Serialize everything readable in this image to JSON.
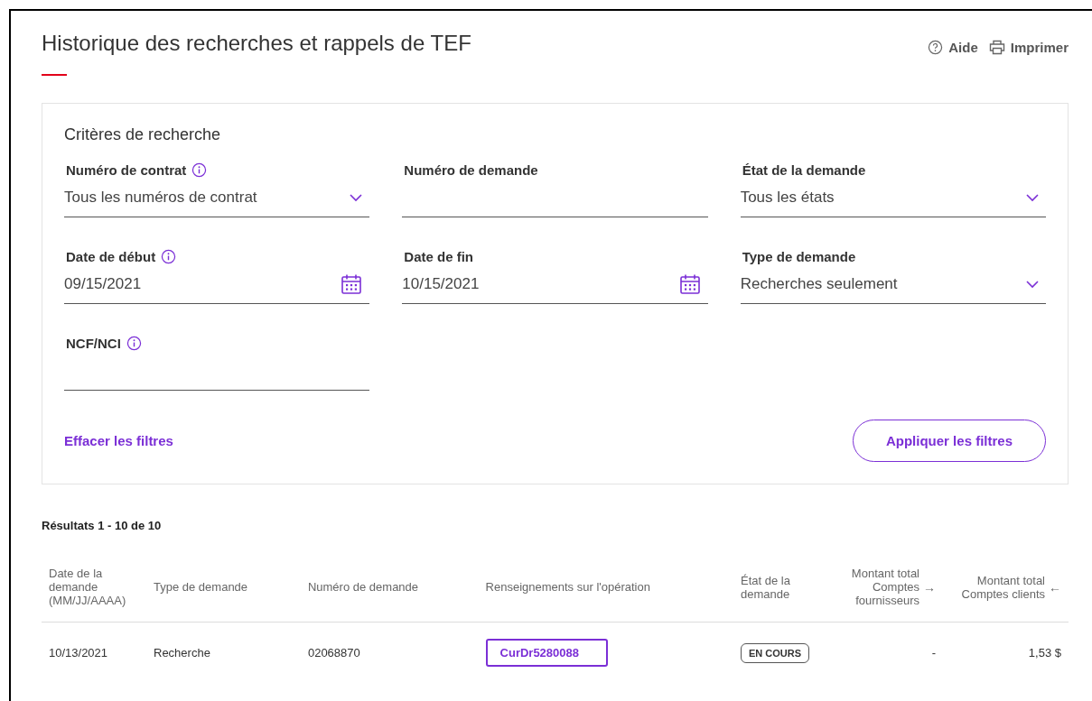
{
  "page": {
    "title": "Historique des recherches et rappels de TEF",
    "actions": [
      {
        "kind": "help",
        "label": "Aide"
      },
      {
        "kind": "print",
        "label": "Imprimer"
      }
    ]
  },
  "criteria": {
    "title": "Critères de recherche",
    "fields": [
      {
        "kind": "select",
        "label": "Numéro de contrat",
        "info": true,
        "value": "Tous les numéros de contrat"
      },
      {
        "kind": "text",
        "label": "Numéro de demande",
        "info": false
      },
      {
        "kind": "select",
        "label": "État de la demande",
        "info": false,
        "value": "Tous les états"
      },
      {
        "kind": "date",
        "label": "Date de début",
        "info": true,
        "value": "09/15/2021"
      },
      {
        "kind": "date",
        "label": "Date de fin",
        "info": false,
        "value": "10/15/2021"
      },
      {
        "kind": "select",
        "label": "Type de demande",
        "info": false,
        "value": "Recherches seulement"
      },
      {
        "kind": "text",
        "label": "NCF/NCI",
        "info": true
      }
    ],
    "clear_link": "Effacer les filtres",
    "apply_button": "Appliquer les filtres"
  },
  "results": {
    "summary": "Résultats 1 - 10 de 10",
    "columns": [
      {
        "label": "Date de la demande (MM/JJ/AAAA)"
      },
      {
        "label": "Type de demande"
      },
      {
        "label": "Numéro de demande"
      },
      {
        "label": "Renseignements sur l'opération"
      },
      {
        "label": "État de la demande"
      },
      {
        "label": "Montant total Comptes fournisseurs",
        "arrow": "→"
      },
      {
        "label": "Montant total Comptes clients",
        "arrow": "←"
      }
    ],
    "rows": [
      {
        "date": "10/13/2021",
        "type": "Recherche",
        "number": "02068870",
        "info": "CurDr5280088",
        "focused": true,
        "status": "EN COURS",
        "payables": "-",
        "receivables": "1,53 $"
      }
    ]
  }
}
